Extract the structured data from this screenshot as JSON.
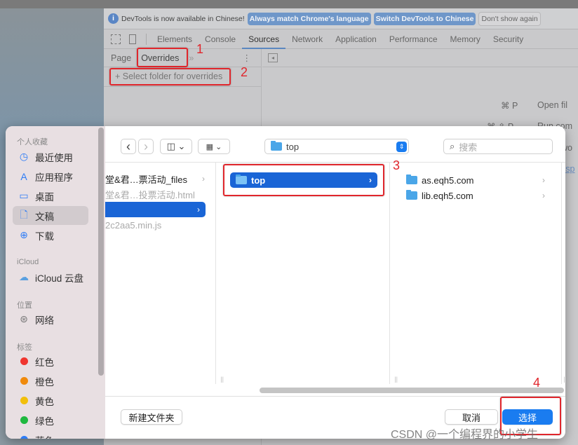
{
  "devtools": {
    "infobar": {
      "message": "DevTools is now available in Chinese!",
      "btn_match": "Always match Chrome's language",
      "btn_switch": "Switch DevTools to Chinese",
      "btn_dont": "Don't show again"
    },
    "tabs": [
      "Elements",
      "Console",
      "Sources",
      "Network",
      "Application",
      "Performance",
      "Memory",
      "Security"
    ],
    "active_tab": "Sources",
    "navigator": {
      "tab_page": "Page",
      "tab_overrides": "Overrides",
      "more": "»",
      "select_folder": "+ Select folder for overrides"
    },
    "editor": {
      "shortcut1_key": "⌘ P",
      "shortcut1_label": "Open fil",
      "shortcut2_key": "⌘ ⇧ P",
      "shortcut2_label": "Run com",
      "partial3": "wo",
      "partial4": "ksp"
    }
  },
  "annotations": [
    "1",
    "2",
    "3",
    "4"
  ],
  "dialog": {
    "sidebar": {
      "favorites_header": "个人收藏",
      "favorites": [
        {
          "label": "最近使用",
          "icon": "clock-icon"
        },
        {
          "label": "应用程序",
          "icon": "apps-icon"
        },
        {
          "label": "桌面",
          "icon": "desktop-icon"
        },
        {
          "label": "文稿",
          "icon": "document-icon",
          "selected": true
        },
        {
          "label": "下载",
          "icon": "download-icon"
        }
      ],
      "icloud_header": "iCloud",
      "icloud": [
        {
          "label": "iCloud 云盘",
          "icon": "cloud-icon"
        }
      ],
      "locations_header": "位置",
      "locations": [
        {
          "label": "网络",
          "icon": "network-icon"
        }
      ],
      "tags_header": "标签",
      "tags": [
        {
          "label": "红色",
          "color": "#f0352f"
        },
        {
          "label": "橙色",
          "color": "#f08a0c"
        },
        {
          "label": "黄色",
          "color": "#f2bf0b"
        },
        {
          "label": "绿色",
          "color": "#1fb83f"
        },
        {
          "label": "蓝色",
          "color": "#2e7cf6"
        }
      ]
    },
    "toolbar": {
      "back": "‹",
      "forward": "›",
      "location": "top",
      "search_placeholder": "搜索"
    },
    "columns": [
      [
        {
          "name": "堂&君…票活动_files",
          "folder": true
        },
        {
          "name": "堂&君…投票活动.html",
          "dim": true
        },
        {
          "name": "",
          "selected": true,
          "folder": true
        },
        {
          "name": "2c2aa5.min.js",
          "dim": true
        }
      ],
      [
        {
          "name": "top",
          "selected": true,
          "folder": true
        }
      ],
      [
        {
          "name": "as.eqh5.com",
          "folder": true
        },
        {
          "name": "lib.eqh5.com",
          "folder": true
        }
      ]
    ],
    "buttons": {
      "new_folder": "新建文件夹",
      "cancel": "取消",
      "choose": "选择"
    },
    "accent": "#1a7cf0"
  },
  "watermark": "CSDN @一个编程界的小学生"
}
